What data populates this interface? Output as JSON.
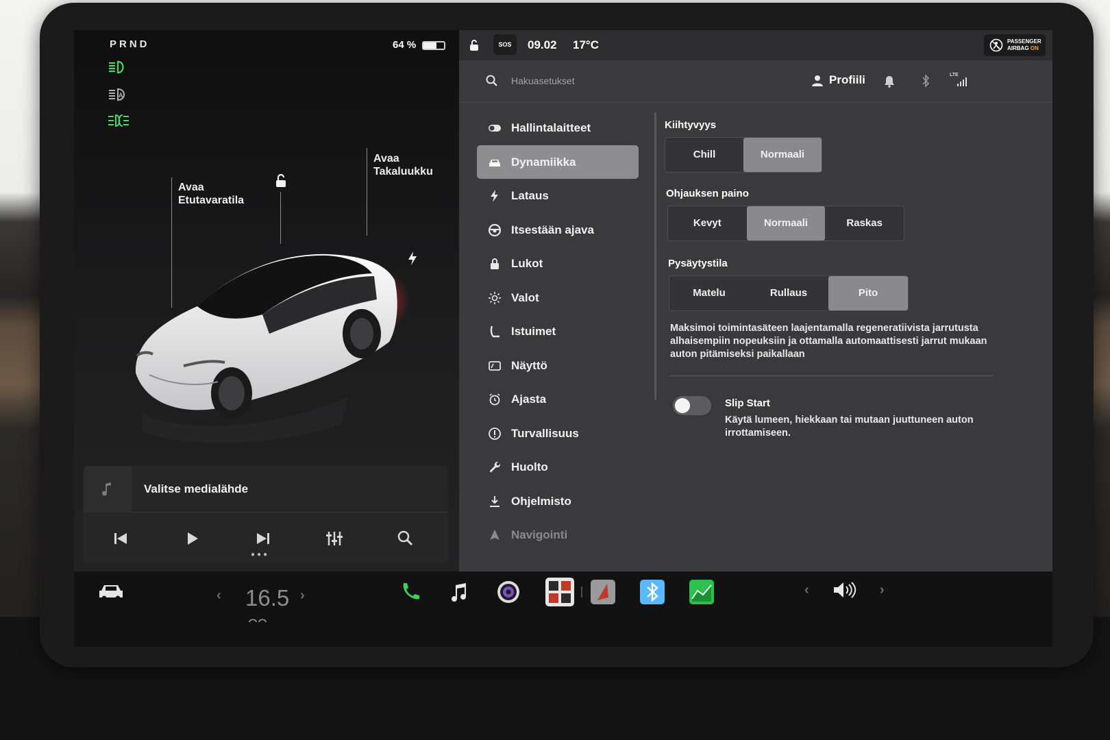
{
  "car_panel": {
    "gear": "PRND",
    "battery_text": "64 %",
    "battery_level": 0.64,
    "open_frunk_line1": "Avaa",
    "open_frunk_line2": "Etutavaratila",
    "open_trunk_line1": "Avaa",
    "open_trunk_line2": "Takaluukku",
    "indicator_icons": [
      "headlights-on-icon",
      "auto-highbeam-icon",
      "fog-lights-icon"
    ],
    "indicator_color": "#4ad863"
  },
  "media": {
    "source_label": "Valitse medialähde",
    "controls": [
      "previous-track-icon",
      "play-icon",
      "next-track-icon",
      "equalizer-icon",
      "search-icon"
    ]
  },
  "status_bar": {
    "sos": "SOS",
    "time": "09.02",
    "temperature": "17°C",
    "airbag_line1": "PASSENGER",
    "airbag_line2": "AIRBAG",
    "airbag_state": "ON",
    "airbag_state_color": "#f5a623"
  },
  "topbar": {
    "search_placeholder": "Hakuasetukset",
    "profile_label": "Profiili",
    "network": "LTE"
  },
  "menu": {
    "items": [
      {
        "label": "Hallintalaitteet",
        "icon": "toggle-icon"
      },
      {
        "label": "Dynamiikka",
        "icon": "car-icon",
        "active": true
      },
      {
        "label": "Lataus",
        "icon": "bolt-icon"
      },
      {
        "label": "Itsestään ajava",
        "icon": "steering-wheel-icon"
      },
      {
        "label": "Lukot",
        "icon": "lock-icon"
      },
      {
        "label": "Valot",
        "icon": "sun-icon"
      },
      {
        "label": "Istuimet",
        "icon": "seat-icon"
      },
      {
        "label": "Näyttö",
        "icon": "display-icon"
      },
      {
        "label": "Ajasta",
        "icon": "alarm-clock-icon"
      },
      {
        "label": "Turvallisuus",
        "icon": "info-circle-icon"
      },
      {
        "label": "Huolto",
        "icon": "wrench-icon"
      },
      {
        "label": "Ohjelmisto",
        "icon": "download-icon"
      },
      {
        "label": "Navigointi",
        "icon": "navigation-icon"
      }
    ]
  },
  "dynamics": {
    "acceleration": {
      "title": "Kiihtyvyys",
      "options": [
        "Chill",
        "Normaali"
      ],
      "selected": "Normaali"
    },
    "steering": {
      "title": "Ohjauksen paino",
      "options": [
        "Kevyt",
        "Normaali",
        "Raskas"
      ],
      "selected": "Normaali"
    },
    "stopping": {
      "title": "Pysäytystila",
      "options": [
        "Matelu",
        "Rullaus",
        "Pito"
      ],
      "selected": "Pito",
      "description": "Maksimoi toimintasäteen laajentamalla regeneratiivista jarrutusta alhaisempiin nopeuksiin ja ottamalla automaattisesti jarrut mukaan auton pitämiseksi paikallaan"
    },
    "slip_start": {
      "title": "Slip Start",
      "enabled": false,
      "description": "Käytä lumeen, hiekkaan tai mutaan juuttuneen auton irrottamiseen."
    }
  },
  "dock": {
    "temperature": "16.5",
    "apps": [
      "phone-icon",
      "music-icon",
      "camera-icon",
      "toybox-icon",
      "dashcam-icon",
      "bluetooth-icon",
      "energy-app-icon"
    ],
    "phone_color": "#3ad35a",
    "energy_color": "#2fbf4e",
    "bluetooth_color": "#5ab8ff"
  }
}
